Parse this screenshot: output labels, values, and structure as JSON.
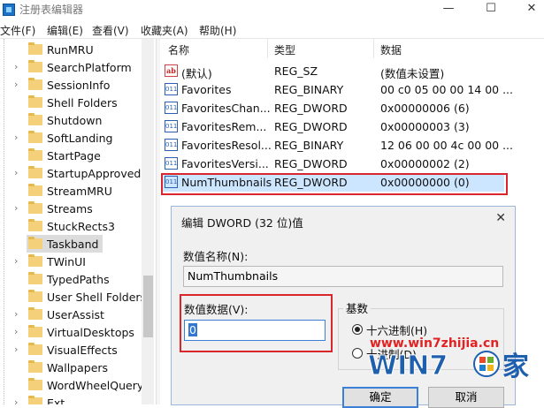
{
  "window": {
    "title": "注册表编辑器",
    "minimize": "—",
    "maximize": "☐",
    "close": "✕"
  },
  "menu": [
    "文件(F)",
    "编辑(E)",
    "查看(V)",
    "收藏夹(A)",
    "帮助(H)"
  ],
  "tree": {
    "items": [
      "RunMRU",
      "SearchPlatform",
      "SessionInfo",
      "Shell Folders",
      "Shutdown",
      "SoftLanding",
      "StartPage",
      "StartupApproved",
      "StreamMRU",
      "Streams",
      "StuckRects3",
      "Taskband",
      "TWinUI",
      "TypedPaths",
      "User Shell Folders",
      "UserAssist",
      "VirtualDesktops",
      "VisualEffects",
      "Wallpapers",
      "WordWheelQuery",
      "Ext"
    ],
    "expandable": [
      false,
      true,
      true,
      false,
      false,
      true,
      false,
      true,
      false,
      true,
      false,
      false,
      true,
      false,
      false,
      true,
      true,
      true,
      false,
      false,
      true
    ],
    "selected": "Taskband"
  },
  "list": {
    "headers": {
      "name": "名称",
      "type": "类型",
      "data": "数据"
    },
    "rows": [
      {
        "icon": "string-value-icon",
        "glyph": "ab",
        "name": "(默认)",
        "type": "REG_SZ",
        "data": "(数值未设置)"
      },
      {
        "icon": "binary-value-icon",
        "glyph": "011",
        "name": "Favorites",
        "type": "REG_BINARY",
        "data": "00 c0 05 00 00 14 00 ..."
      },
      {
        "icon": "dword-value-icon",
        "glyph": "011",
        "name": "FavoritesChan...",
        "type": "REG_DWORD",
        "data": "0x00000006 (6)"
      },
      {
        "icon": "dword-value-icon",
        "glyph": "011",
        "name": "FavoritesRem...",
        "type": "REG_DWORD",
        "data": "0x00000003 (3)"
      },
      {
        "icon": "binary-value-icon",
        "glyph": "011",
        "name": "FavoritesResol...",
        "type": "REG_BINARY",
        "data": "12 06 00 00 4c 00 00 ..."
      },
      {
        "icon": "dword-value-icon",
        "glyph": "011",
        "name": "FavoritesVersi...",
        "type": "REG_DWORD",
        "data": "0x00000002 (2)"
      },
      {
        "icon": "dword-value-icon",
        "glyph": "011",
        "name": "NumThumbnails",
        "type": "REG_DWORD",
        "data": "0x00000000 (0)"
      }
    ],
    "selected_index": 6
  },
  "dialog": {
    "title": "编辑 DWORD (32 位)值",
    "close": "✕",
    "name_label": "数值名称(N):",
    "name_value": "NumThumbnails",
    "data_label": "数值数据(V):",
    "data_value": "0",
    "base_label": "基数",
    "hex_label": "十六进制(H)",
    "dec_label": "十进制(D)",
    "hex_selected": true,
    "ok": "确定",
    "cancel": "取消"
  },
  "watermark": {
    "url": "www.win7zhijia.cn",
    "logo_text": "WIN7",
    "logo_char": "家"
  }
}
